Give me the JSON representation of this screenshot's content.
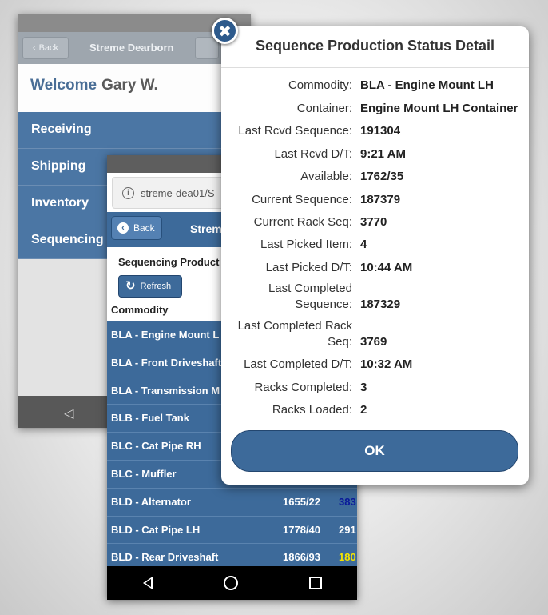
{
  "back_app": {
    "back_label": "Back",
    "title": "Streme Dearborn",
    "welcome_label": "Welcome",
    "user_name": "Gary W.",
    "menu_items": [
      "Receiving",
      "Shipping",
      "Inventory",
      "Sequencing"
    ]
  },
  "mid_app": {
    "url": "streme-dea01/S",
    "back_label": "Back",
    "title": "Strem",
    "section_heading": "Sequencing Product",
    "refresh_label": "Refresh",
    "column_header": "Commodity",
    "rows": [
      {
        "name": "BLA - Engine Mount L",
        "avail": "",
        "seq": "",
        "seq_color": "#ffffff"
      },
      {
        "name": "BLA - Front Driveshaft",
        "avail": "",
        "seq": "",
        "seq_color": "#ffffff"
      },
      {
        "name": "BLA - Transmission M",
        "avail": "",
        "seq": "",
        "seq_color": "#ffffff"
      },
      {
        "name": "BLB - Fuel Tank",
        "avail": "",
        "seq": "",
        "seq_color": "#ffffff"
      },
      {
        "name": "BLC - Cat Pipe RH",
        "avail": "",
        "seq": "",
        "seq_color": "#ffffff"
      },
      {
        "name": "BLC - Muffler",
        "avail": "",
        "seq": "",
        "seq_color": "#ffffff"
      },
      {
        "name": "BLD - Alternator",
        "avail": "1655/22",
        "seq": "383",
        "seq_color": "#0a1a9a"
      },
      {
        "name": "BLD - Cat Pipe LH",
        "avail": "1778/40",
        "seq": "291",
        "seq_color": "#ffffff"
      },
      {
        "name": "BLD - Rear Driveshaft",
        "avail": "1866/93",
        "seq": "180",
        "seq_color": "#f5e400"
      }
    ]
  },
  "dialog": {
    "title": "Sequence Production Status Detail",
    "fields": [
      {
        "label": "Commodity:",
        "value": "BLA - Engine Mount LH"
      },
      {
        "label": "Container:",
        "value": "Engine Mount LH Container"
      },
      {
        "label": "Last Rcvd Sequence:",
        "value": "191304"
      },
      {
        "label": "Last Rcvd D/T:",
        "value": "9:21 AM"
      },
      {
        "label": "Available:",
        "value": "1762/35"
      },
      {
        "label": "Current Sequence:",
        "value": "187379"
      },
      {
        "label": "Current Rack Seq:",
        "value": "3770"
      },
      {
        "label": "Last Picked Item:",
        "value": "4"
      },
      {
        "label": "Last Picked D/T:",
        "value": "10:44 AM"
      },
      {
        "label": "Last Completed Sequence:",
        "value": "187329"
      },
      {
        "label": "Last Completed Rack Seq:",
        "value": "3769"
      },
      {
        "label": "Last Completed D/T:",
        "value": "10:32 AM"
      },
      {
        "label": "Racks Completed:",
        "value": "3"
      },
      {
        "label": "Racks Loaded:",
        "value": "2"
      }
    ],
    "ok_label": "OK",
    "close_glyph": "✖"
  }
}
